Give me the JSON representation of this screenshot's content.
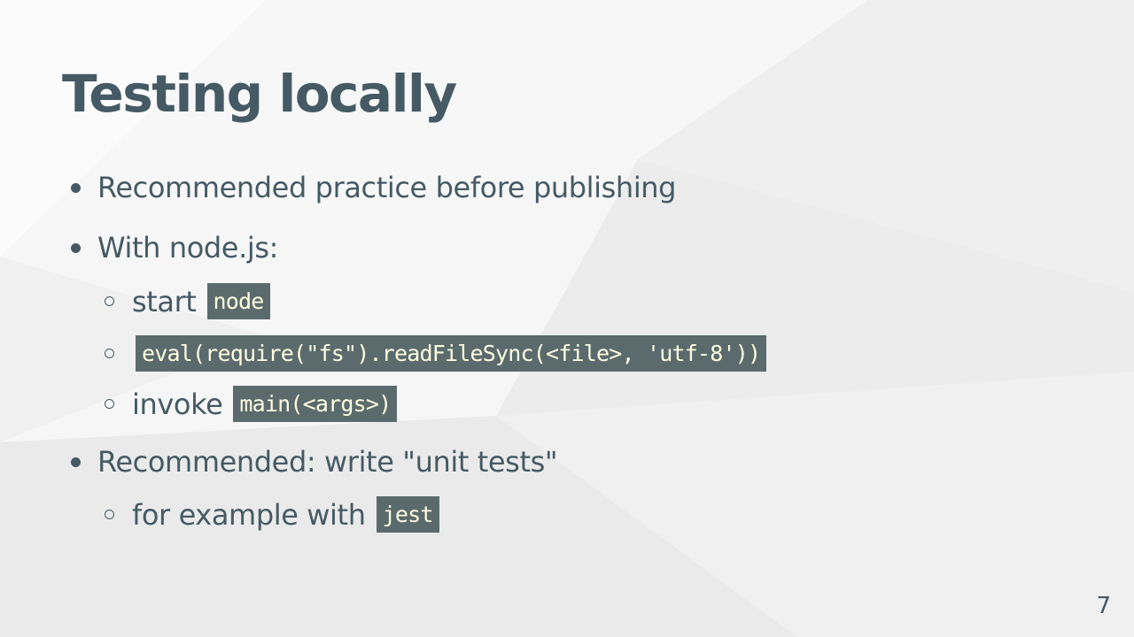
{
  "slide": {
    "title": "Testing locally",
    "page_number": "7",
    "bullets": {
      "b1": "Recommended practice before publishing",
      "b2": "With node.js:",
      "b2_1_text": "start",
      "b2_1_code": "node",
      "b2_2_code": "eval(require(\"fs\").readFileSync(<file>, 'utf-8'))",
      "b2_3_text": "invoke",
      "b2_3_code": "main(<args>)",
      "b3": "Recommended: write \"unit tests\"",
      "b3_1_text": "for example with",
      "b3_1_code": "jest"
    }
  },
  "colors": {
    "text": "#455a64",
    "code_background": "#5b6b6d",
    "code_text": "#fffde0",
    "background": "#f3f3f3"
  }
}
